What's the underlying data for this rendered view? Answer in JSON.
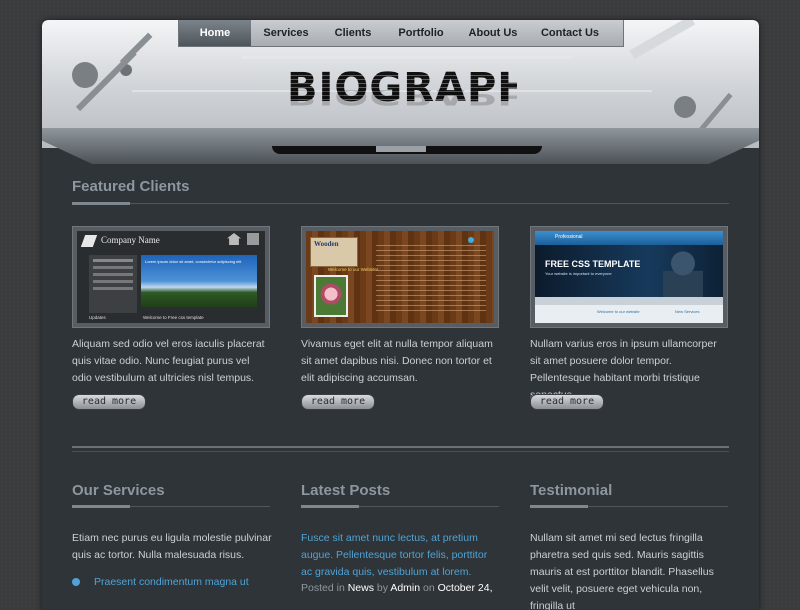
{
  "nav": {
    "items": [
      {
        "label": "Home",
        "active": true
      },
      {
        "label": "Services",
        "active": false
      },
      {
        "label": "Clients",
        "active": false
      },
      {
        "label": "Portfolio",
        "active": false
      },
      {
        "label": "About Us",
        "active": false
      },
      {
        "label": "Contact Us",
        "active": false
      }
    ]
  },
  "logo": {
    "text": "BIOGRAPH"
  },
  "featured": {
    "title": "Featured Clients",
    "clients": [
      {
        "desc": "Aliquam sed odio vel eros iaculis placerat quis vitae odio. Nunc feugiat purus vel odio vestibulum at ultricies nisl tempus.",
        "read_more": "read more",
        "thumb": {
          "company": "Company Name",
          "tagline": "Lorem ipsum dolor sit amet, consectetur adipiscing elit",
          "footer_left": "Updates",
          "footer_right": "Welcome to Free css template"
        }
      },
      {
        "desc": "Vivamus eget elit at nulla tempor aliquam sit amet dapibus nisi. Donec non tortor et elit adipiscing accumsan.",
        "read_more": "read more",
        "thumb": {
          "brand": "Wooden",
          "welcome": "Welcome to our Website!"
        }
      },
      {
        "desc": "Nullam varius eros in ipsum ullamcorper sit amet posuere dolor tempor. Pellentesque habitant morbi tristique senectus.",
        "read_more": "read more",
        "thumb": {
          "brand": "Professional",
          "headline": "FREE CSS TEMPLATE",
          "sub": "Your website is important to everyone",
          "welcome": "Welcome to our website",
          "news": "New Services"
        }
      }
    ]
  },
  "services": {
    "title": "Our Services",
    "text": "Etiam nec purus eu ligula molestie pulvinar quis ac tortor. Nulla malesuada risus.",
    "items": [
      "Praesent condimentum magna ut"
    ]
  },
  "posts": {
    "title": "Latest Posts",
    "link": "Fusce sit amet nunc lectus, at pretium augue. Pellentesque tortor felis, porttitor ac gravida quis, vestibulum at lorem.",
    "meta_posted": "Posted in",
    "meta_category": "News",
    "meta_by": "by",
    "meta_author": "Admin",
    "meta_on": "on",
    "meta_date": "October 24,"
  },
  "testimonial": {
    "title": "Testimonial",
    "text": "Nullam sit amet mi sed lectus fringilla pharetra sed quis sed. Mauris sagittis mauris at est porttitor blandit. Phasellus velit velit, posuere eget vehicula non, fringilla ut"
  },
  "colors": {
    "accent": "#4fa3d6",
    "background": "#2f3438",
    "heading": "#8e979f"
  }
}
